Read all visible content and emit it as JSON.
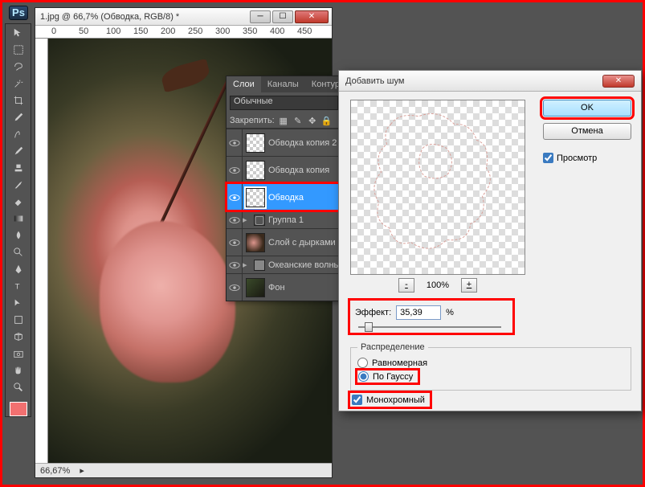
{
  "app": {
    "ps_icon": "Ps"
  },
  "document": {
    "title": "1.jpg @ 66,7% (Обводка, RGB/8) *",
    "zoom_status": "66,67%",
    "ruler_marks": [
      "0",
      "50",
      "100",
      "150",
      "200",
      "250",
      "300",
      "350",
      "400",
      "450"
    ]
  },
  "layers_panel": {
    "tabs": [
      "Слои",
      "Каналы",
      "Контур"
    ],
    "blend_mode": "Обычные",
    "lock_label": "Закрепить:",
    "layers": [
      {
        "name": "Обводка копия 2",
        "visible": true,
        "thumb": "checker"
      },
      {
        "name": "Обводка копия",
        "visible": true,
        "thumb": "checker"
      },
      {
        "name": "Обводка",
        "visible": true,
        "thumb": "checker",
        "selected": true
      },
      {
        "name": "Группа 1",
        "visible": true,
        "thumb": "group",
        "small": true
      },
      {
        "name": "Слой с дырками",
        "visible": true,
        "thumb": "rose"
      },
      {
        "name": "Океанские волны",
        "visible": true,
        "thumb": "checker",
        "small": true
      },
      {
        "name": "Фон",
        "visible": true,
        "thumb": "photo"
      }
    ]
  },
  "dialog": {
    "title": "Добавить шум",
    "ok": "OK",
    "cancel": "Отмена",
    "preview_label": "Просмотр",
    "preview_checked": true,
    "zoom_minus": "-",
    "zoom_value": "100%",
    "zoom_plus": "+",
    "amount_label": "Эффект:",
    "amount_value": "35,39",
    "amount_unit": "%",
    "distribution": {
      "legend": "Распределение",
      "uniform": "Равномерная",
      "gaussian": "По Гауссу",
      "selected": "gaussian"
    },
    "mono_label": "Монохромный",
    "mono_checked": true
  },
  "swatch_fg": "#f27070"
}
